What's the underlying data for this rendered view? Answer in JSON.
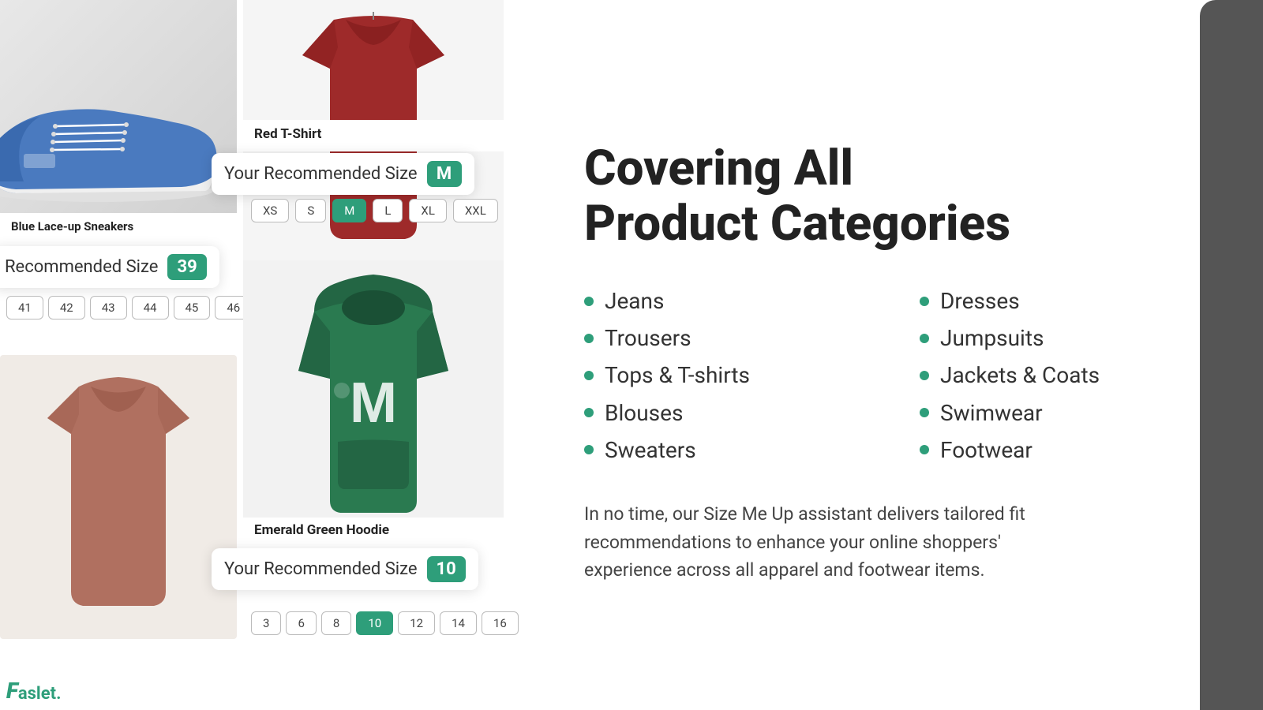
{
  "left": {
    "sneaker_label": "Blue Lace-up Sneakers",
    "sneaker_rec_label": "Recommended Size",
    "sneaker_rec_value": "39",
    "sneaker_sizes": [
      "41",
      "42",
      "43",
      "44",
      "45",
      "46"
    ],
    "tshirt_red_name": "Red T-Shirt",
    "tshirt_rec_label": "Your Recommended Size",
    "tshirt_rec_value": "M",
    "tshirt_sizes": [
      "XS",
      "S",
      "M",
      "L",
      "XL",
      "XXL"
    ],
    "hoodie_name": "Emerald Green Hoodie",
    "hoodie_rec_label": "Your Recommended Size",
    "hoodie_rec_value": "10",
    "hoodie_sizes": [
      "3",
      "6",
      "8",
      "10",
      "12",
      "14",
      "16"
    ],
    "faslet_logo": "aslet."
  },
  "right": {
    "title_line1": "Covering All",
    "title_line2": "Product Categories",
    "categories_left": [
      "Jeans",
      "Trousers",
      "Tops & T-shirts",
      "Blouses",
      "Sweaters"
    ],
    "categories_right": [
      "Dresses",
      "Jumpsuits",
      "Jackets & Coats",
      "Swimwear",
      "Footwear"
    ],
    "description": "In no time, our Size Me Up assistant delivers tailored fit recommendations to enhance your online shoppers' experience across all apparel and footwear items."
  },
  "colors": {
    "green": "#2e9e7a",
    "dark": "#333333",
    "light_bg": "#f5f5f5"
  }
}
